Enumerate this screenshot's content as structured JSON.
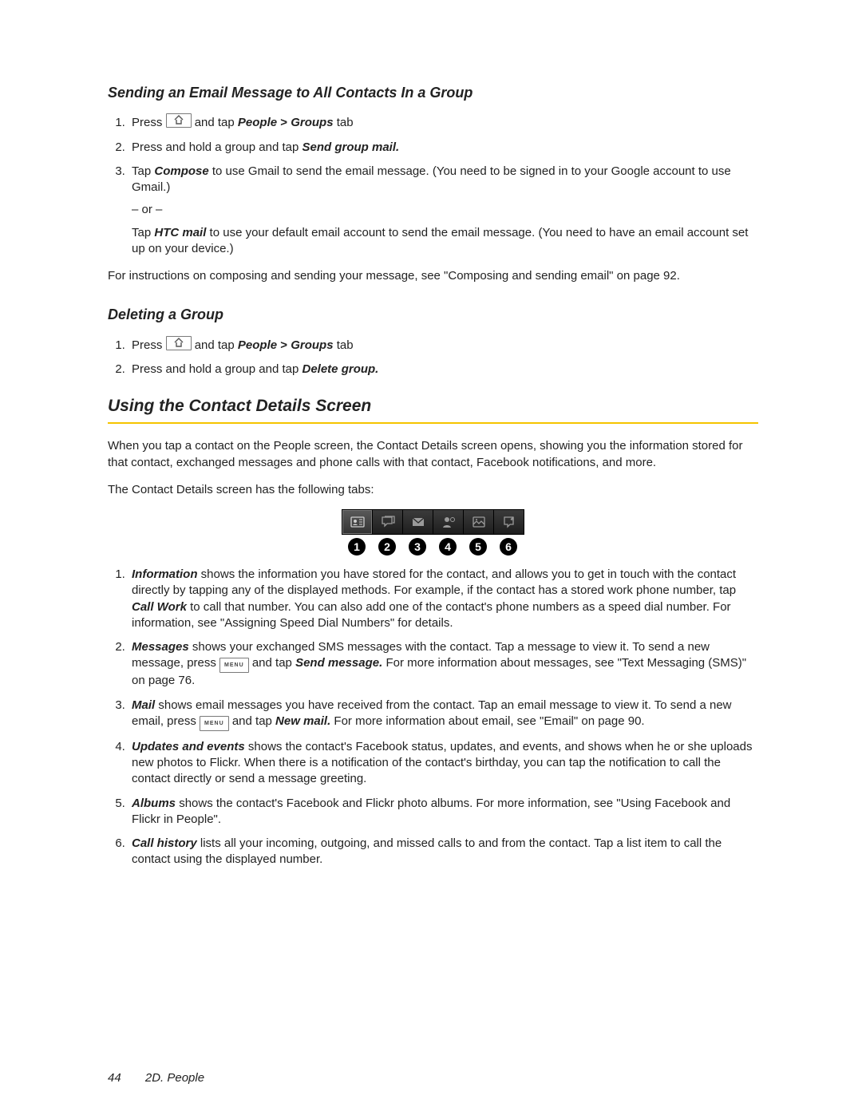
{
  "section_a": {
    "title": "Sending an Email Message to All Contacts In a Group",
    "steps": {
      "s1a": "Press ",
      "s1_tap": " and tap ",
      "s1_people": "People",
      "s1_gt": " > ",
      "s1_groups": "Groups",
      "s1_tab": " tab",
      "s2a": "Press and hold a group and tap ",
      "s2b": "Send group mail.",
      "s3a": "Tap ",
      "s3_compose": "Compose",
      "s3b": " to use Gmail to send the email message. (You need to be signed in to your Google account to use Gmail.)",
      "or": "– or –",
      "s3c": "Tap ",
      "s3_htc": "HTC mail",
      "s3d": " to use your default email account to send the email message. (You need to have an email account set up on your device.)"
    },
    "after": "For instructions on composing and sending your message, see \"Composing and sending email\" on page 92."
  },
  "section_b": {
    "title": "Deleting a Group",
    "steps": {
      "s1a": "Press ",
      "s1_tap": " and tap ",
      "s1_people": "People",
      "s1_gt": " > ",
      "s1_groups": "Groups",
      "s1_tab": " tab",
      "s2a": "Press and hold a group and tap ",
      "s2b": "Delete group."
    }
  },
  "section_c": {
    "title": "Using the Contact Details Screen",
    "intro": "When you tap a contact on the People screen, the Contact Details screen opens, showing you the information stored for that contact, exchanged messages and phone calls with that contact, Facebook notifications, and more.",
    "lead": "The Contact Details screen has the following tabs:",
    "tabs": {
      "t1_name": "Information",
      "t1_text": " shows the information you have stored for the contact, and allows you to get in touch with the contact directly by tapping any of the displayed methods. For example, if the contact has a stored work phone number, tap ",
      "t1_cw": "Call Work",
      "t1_text2": " to call that number. You can also add one of the contact's phone numbers as a speed dial number. For information, see \"Assigning Speed Dial Numbers\" for details.",
      "t2_name": "Messages",
      "t2_a": " shows your exchanged SMS messages with the contact. Tap a message to view it. To send a new message, press ",
      "t2_tap": " and tap ",
      "t2_sm": "Send message.",
      "t2_b": " For more information about messages, see \"Text Messaging (SMS)\" on page 76.",
      "t3_name": "Mail",
      "t3_a": " shows email messages you have received from the contact. Tap an email message to view it. To send a new email, press ",
      "t3_tap": " and tap ",
      "t3_nm": "New mail.",
      "t3_b": " For more information about email, see \"Email\" on page 90.",
      "t4_name": "Updates and events",
      "t4_text": " shows the contact's Facebook status, updates, and events, and shows when he or she uploads new photos to Flickr. When there is a notification of the contact's birthday, you can tap the notification to call the contact directly or send a message greeting.",
      "t5_name": "Albums",
      "t5_text": " shows the contact's Facebook and Flickr photo albums. For more information, see \"Using Facebook and Flickr in People\".",
      "t6_name": "Call history",
      "t6_text": " lists all your incoming, outgoing, and missed calls to and from the contact. Tap a list item to call the contact using the displayed number."
    },
    "tab_icons": [
      "card",
      "chat",
      "mail",
      "person",
      "calendar",
      "callout"
    ],
    "nums": [
      "1",
      "2",
      "3",
      "4",
      "5",
      "6"
    ]
  },
  "keys": {
    "menu_label": "menu"
  },
  "footer": {
    "page": "44",
    "section": "2D. People"
  }
}
